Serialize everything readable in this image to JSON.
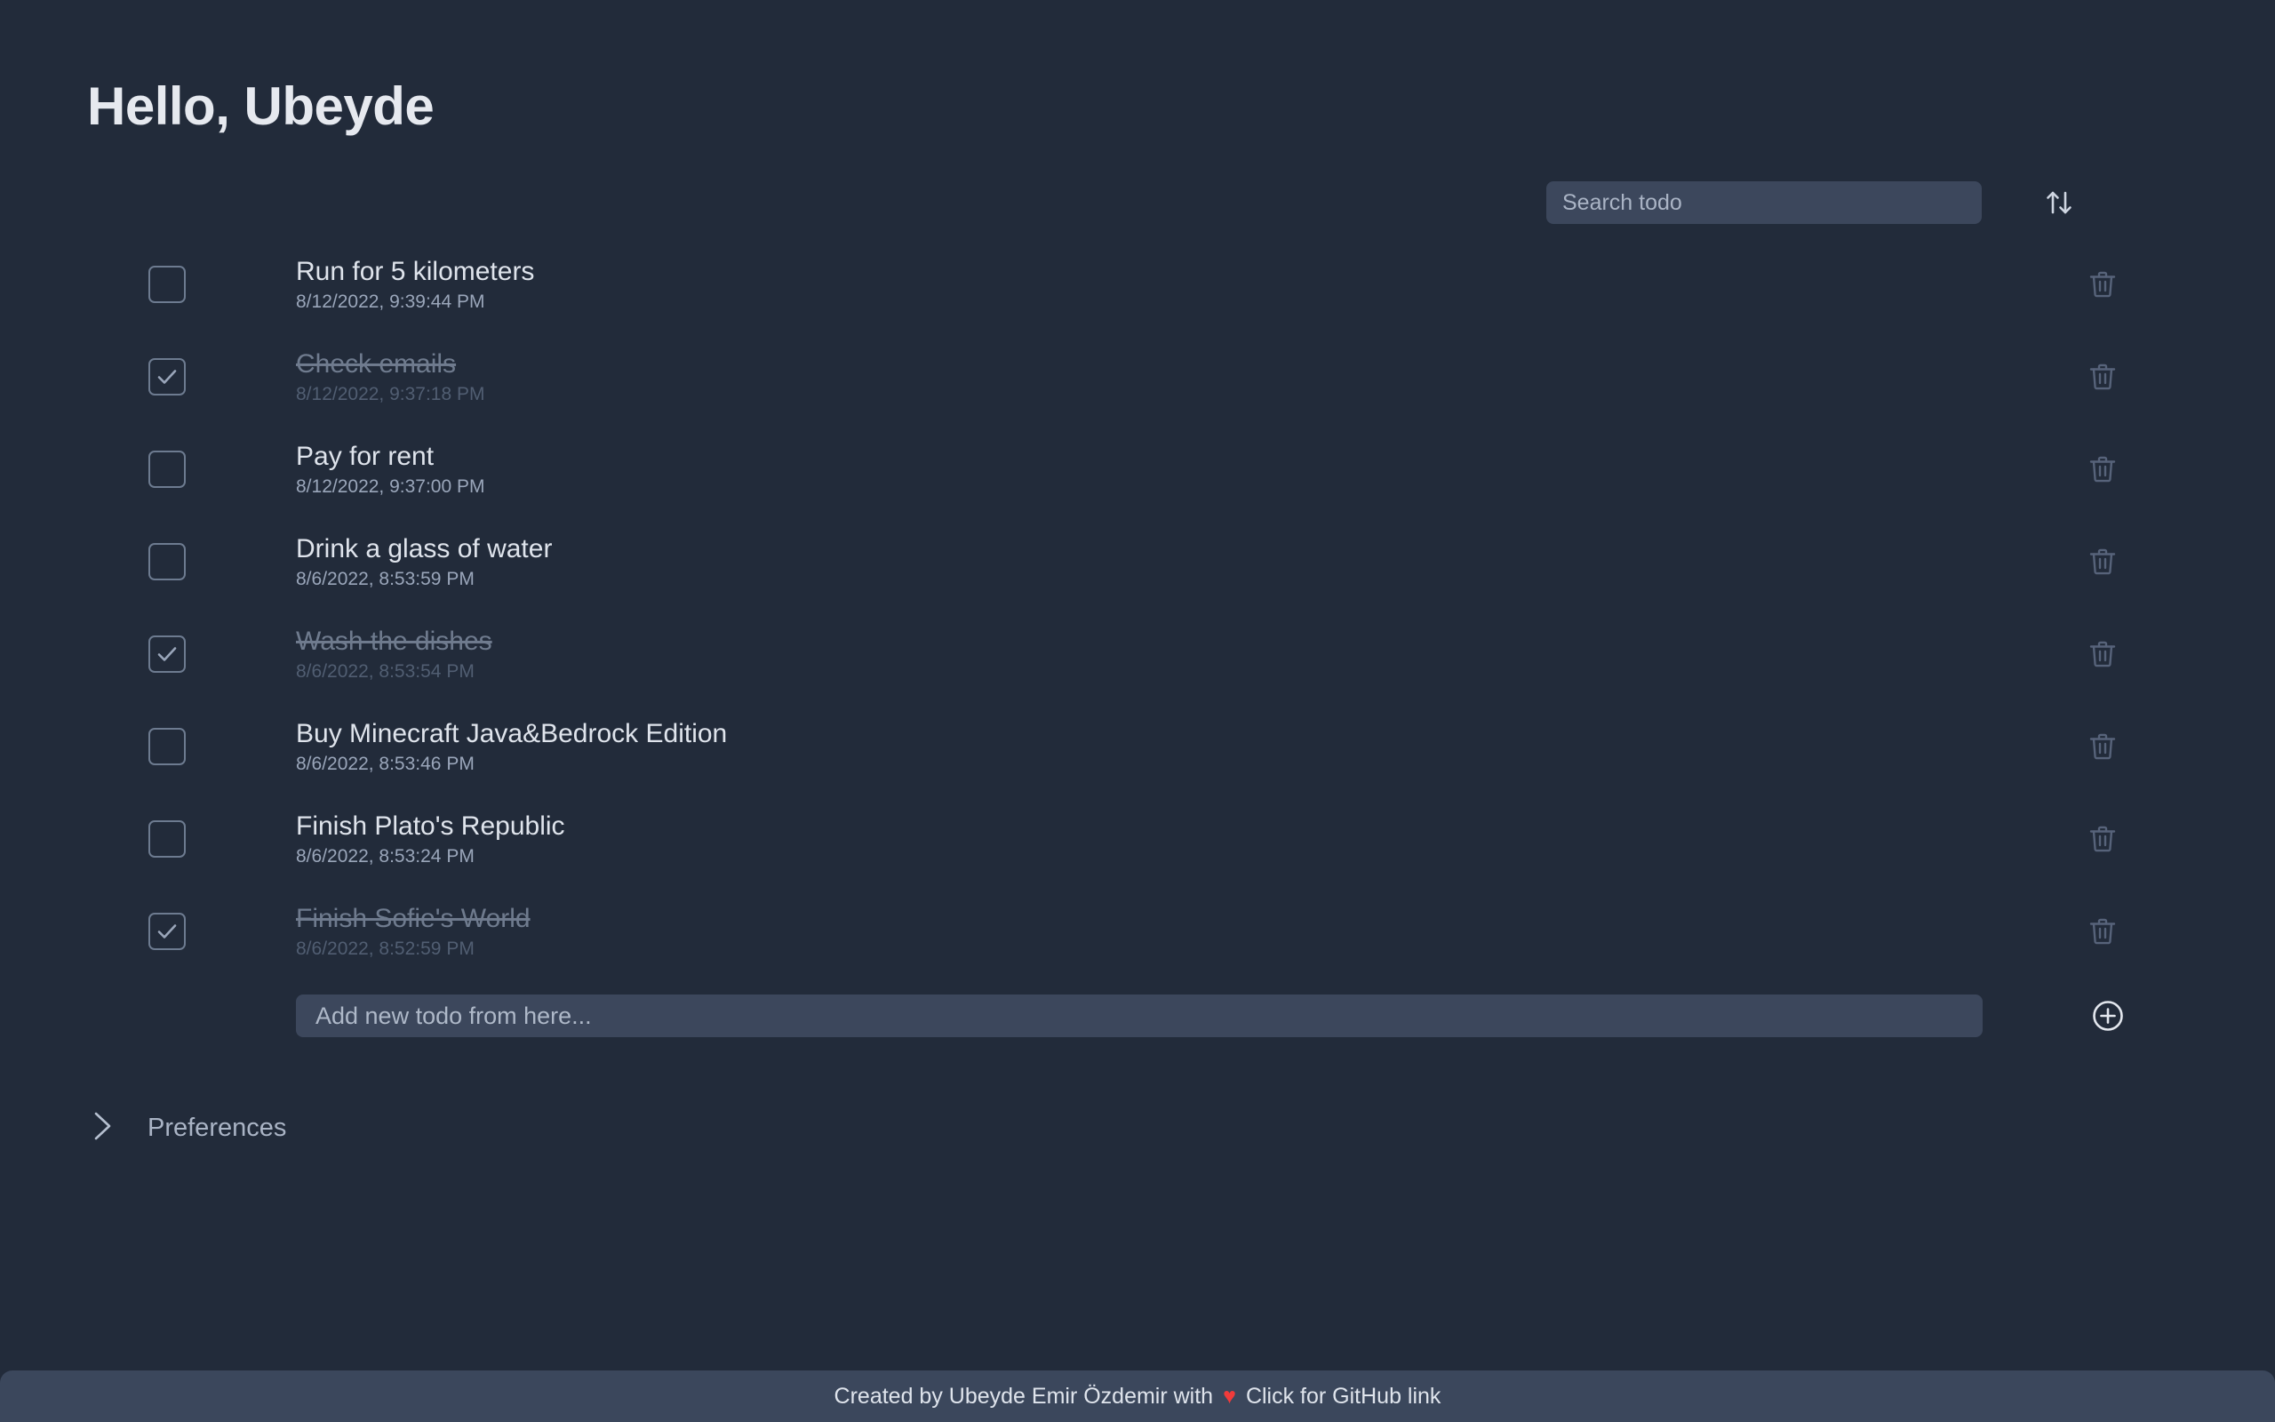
{
  "header": {
    "greeting": "Hello, Ubeyde"
  },
  "toolbar": {
    "search_placeholder": "Search todo",
    "search_value": "",
    "sort_icon": "sort-arrows-icon"
  },
  "todos": [
    {
      "title": "Run for 5 kilometers",
      "date": "8/12/2022, 9:39:44 PM",
      "done": false
    },
    {
      "title": "Check emails",
      "date": "8/12/2022, 9:37:18 PM",
      "done": true
    },
    {
      "title": "Pay for rent",
      "date": "8/12/2022, 9:37:00 PM",
      "done": false
    },
    {
      "title": "Drink a glass of water",
      "date": "8/6/2022, 8:53:59 PM",
      "done": false
    },
    {
      "title": "Wash the dishes",
      "date": "8/6/2022, 8:53:54 PM",
      "done": true
    },
    {
      "title": "Buy Minecraft Java&Bedrock Edition",
      "date": "8/6/2022, 8:53:46 PM",
      "done": false
    },
    {
      "title": "Finish Plato's Republic",
      "date": "8/6/2022, 8:53:24 PM",
      "done": false
    },
    {
      "title": "Finish Sofie's World",
      "date": "8/6/2022, 8:52:59 PM",
      "done": true
    }
  ],
  "add": {
    "placeholder": "Add new todo from here...",
    "value": "",
    "button_icon": "plus-circle-icon"
  },
  "preferences": {
    "label": "Preferences",
    "icon": "chevron-right-icon",
    "expanded": false
  },
  "footer": {
    "text_before": "Created by Ubeyde Emir Özdemir with",
    "heart": "♥",
    "text_after": "Click for GitHub link"
  },
  "colors": {
    "background": "#222b3a",
    "input_background": "#3c475c",
    "footer_background": "#3b475c",
    "text_primary": "#dfe4ec",
    "text_muted": "#9aa6ba",
    "text_done": "#6f7b8e",
    "heart": "#f03b3b",
    "outline": "#6d7b90"
  }
}
